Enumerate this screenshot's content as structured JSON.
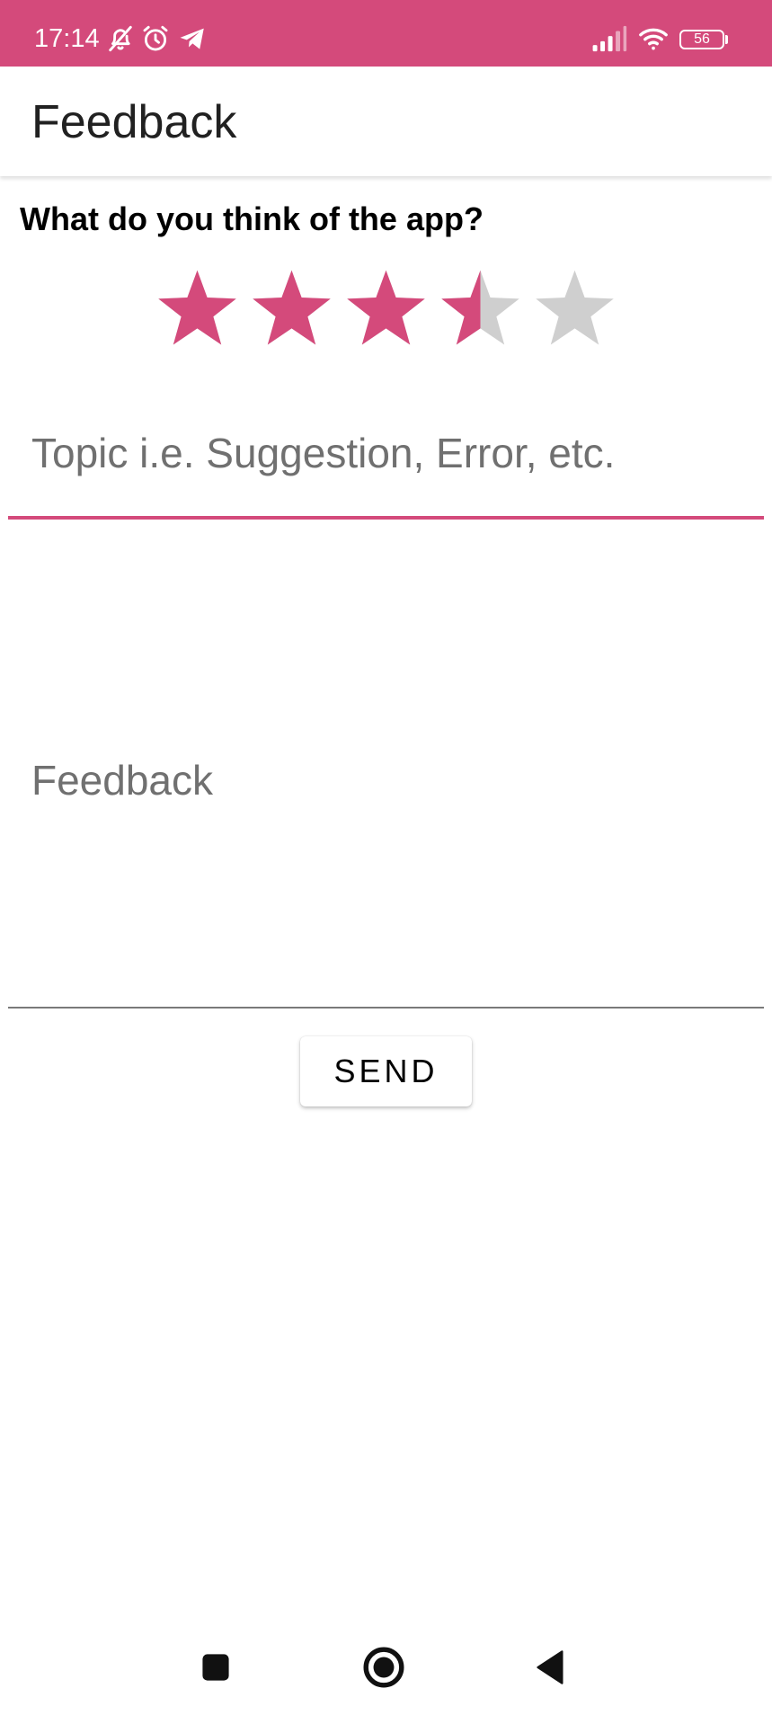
{
  "status_bar": {
    "time": "17:14",
    "battery": "56",
    "background": "#d44a7b",
    "icons": [
      "bell-off-icon",
      "alarm-icon",
      "telegram-icon",
      "signal-icon",
      "wifi-icon",
      "battery-icon"
    ]
  },
  "app_bar": {
    "title": "Feedback"
  },
  "form": {
    "question": "What do you think of the app?",
    "rating": {
      "value": 3.5,
      "max": 5,
      "filled_color": "#d44a7b",
      "empty_color": "#cfcfcf"
    },
    "topic": {
      "placeholder": "Topic i.e. Suggestion, Error, etc.",
      "value": ""
    },
    "feedback": {
      "placeholder": "Feedback",
      "value": ""
    },
    "send_label": "SEND"
  },
  "nav_bar": {
    "icons": [
      "recents-square-icon",
      "home-circle-icon",
      "back-triangle-icon"
    ]
  }
}
